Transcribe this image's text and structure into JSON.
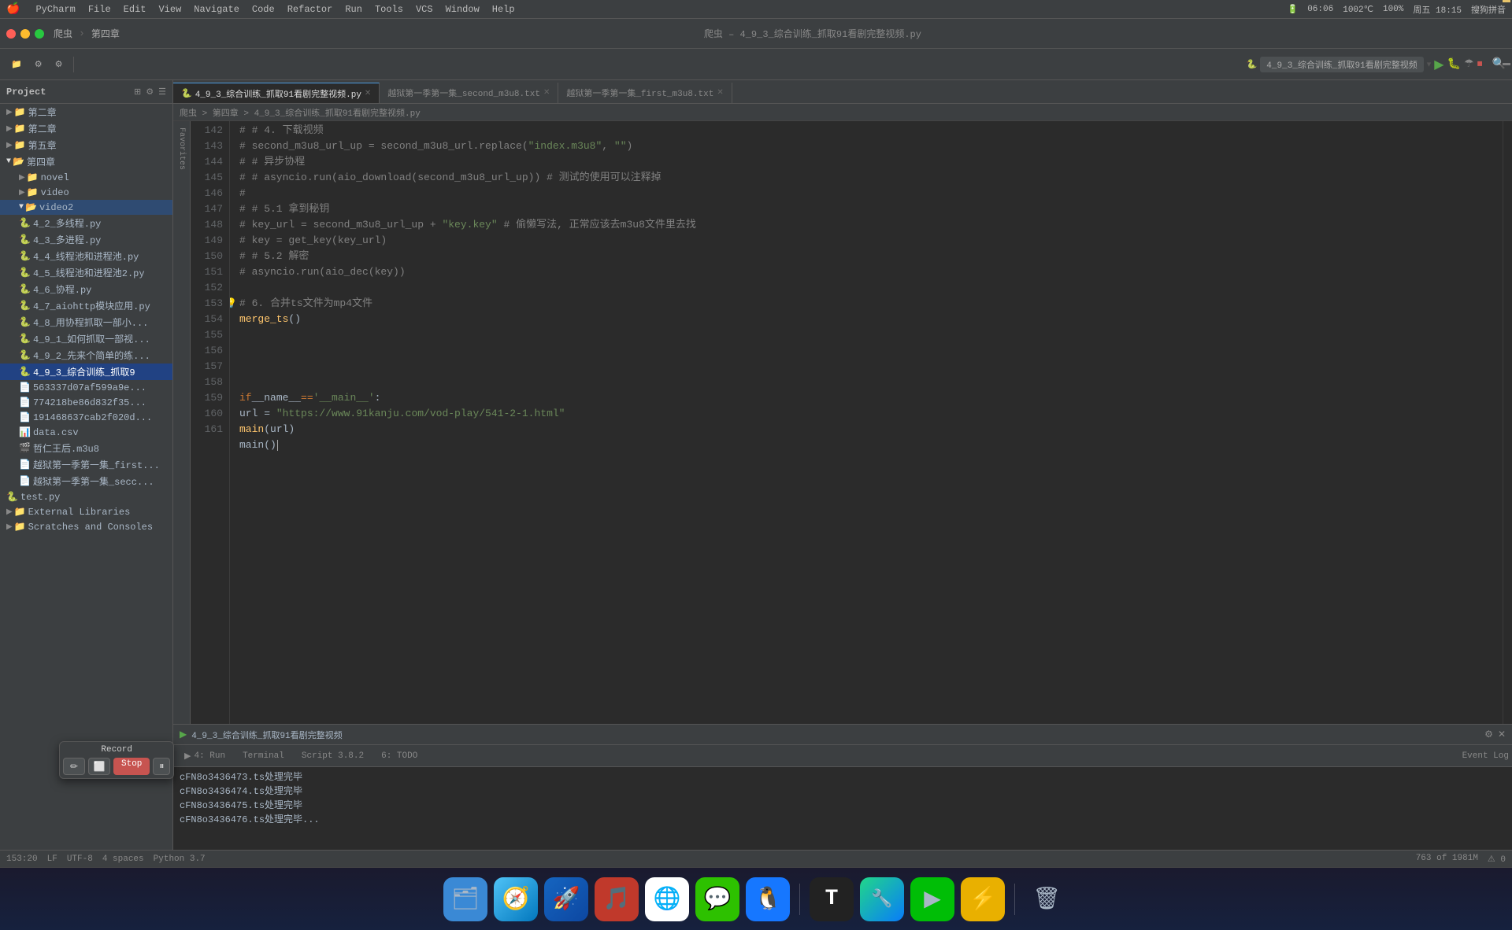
{
  "menubar": {
    "apple": "🍎",
    "items": [
      "PyCharm",
      "File",
      "Edit",
      "View",
      "Navigate",
      "Code",
      "Refactor",
      "Run",
      "Tools",
      "VCS",
      "Window",
      "Help"
    ],
    "right_items": [
      "06:06",
      "1002℃",
      "100%",
      "周五 18:15",
      "搜狗拼音"
    ]
  },
  "titlebar": {
    "title": "爬虫 – 4_9_3_综合训练_抓取91看剧完整视频.py"
  },
  "run_config": {
    "name": "4_9_3_综合训练_抓取91看剧完整视频",
    "run_label": "▶",
    "debug_label": "🐛"
  },
  "project": {
    "title": "Project",
    "tree_items": [
      {
        "label": "第二章",
        "indent": 1,
        "type": "folder",
        "collapsed": true
      },
      {
        "label": "第二章",
        "indent": 1,
        "type": "folder",
        "collapsed": true
      },
      {
        "label": "第五章",
        "indent": 1,
        "type": "folder",
        "collapsed": true
      },
      {
        "label": "第四章",
        "indent": 1,
        "type": "folder",
        "collapsed": false
      },
      {
        "label": "novel",
        "indent": 2,
        "type": "folder",
        "collapsed": true
      },
      {
        "label": "video",
        "indent": 2,
        "type": "folder",
        "collapsed": true
      },
      {
        "label": "video2",
        "indent": 2,
        "type": "folder",
        "collapsed": false,
        "selected": true
      },
      {
        "label": "4_2_多线程.py",
        "indent": 2,
        "type": "py"
      },
      {
        "label": "4_3_多进程.py",
        "indent": 2,
        "type": "py"
      },
      {
        "label": "4_4_线程池和进程池.py",
        "indent": 2,
        "type": "py"
      },
      {
        "label": "4_5_线程池和进程池2.py",
        "indent": 2,
        "type": "py"
      },
      {
        "label": "4_6_协程.py",
        "indent": 2,
        "type": "py"
      },
      {
        "label": "4_7_aiohttp模块应用.py",
        "indent": 2,
        "type": "py"
      },
      {
        "label": "4_8_用协程抓取一部小…",
        "indent": 2,
        "type": "py"
      },
      {
        "label": "4_9_1_如何抓取一部视…",
        "indent": 2,
        "type": "py"
      },
      {
        "label": "4_9_2_先来个简单的练…",
        "indent": 2,
        "type": "py"
      },
      {
        "label": "4_9_3_综合训练_抓取9",
        "indent": 2,
        "type": "py",
        "selected": true
      },
      {
        "label": "563337d07af599a9e…",
        "indent": 2,
        "type": "file"
      },
      {
        "label": "774218be86d832f35…",
        "indent": 2,
        "type": "file"
      },
      {
        "label": "191468637cab2f020d…",
        "indent": 2,
        "type": "file"
      },
      {
        "label": "data.csv",
        "indent": 2,
        "type": "csv"
      },
      {
        "label": "哲仁王后.m3u8",
        "indent": 2,
        "type": "m3u8"
      },
      {
        "label": "越狱第一季第一集_first…",
        "indent": 2,
        "type": "file"
      },
      {
        "label": "越狱第一季第一集_secc…",
        "indent": 2,
        "type": "file"
      },
      {
        "label": "test.py",
        "indent": 1,
        "type": "py"
      },
      {
        "label": "External Libraries",
        "indent": 1,
        "type": "folder",
        "collapsed": true
      },
      {
        "label": "Scratches and Consoles",
        "indent": 1,
        "type": "folder",
        "collapsed": true
      }
    ]
  },
  "tabs": [
    {
      "label": "4_9_3_综合训练_抓取91看剧完整视频.py",
      "active": true
    },
    {
      "label": "越狱第一季第一集_second_m3u8.txt",
      "active": false
    },
    {
      "label": "越狱第一季第一集_first_m3u8.txt",
      "active": false
    }
  ],
  "breadcrumb": "爬虫 > 第四章 > 4_9_3_综合训练_抓取91看剧完整视频.py",
  "code_lines": [
    {
      "num": "142",
      "content": "        # # 4. 下载视频",
      "type": "comment"
    },
    {
      "num": "143",
      "content": "        # second_m3u8_url_up = second_m3u8_url.replace(\"index.m3u8\", \"\")",
      "type": "comment"
    },
    {
      "num": "144",
      "content": "        # # 异步协程",
      "type": "comment"
    },
    {
      "num": "145",
      "content": "        # # asyncio.run(aio_download(second_m3u8_url_up))  # 测试的使用可以注释掉",
      "type": "comment"
    },
    {
      "num": "146",
      "content": "        #",
      "type": "comment"
    },
    {
      "num": "147",
      "content": "        # # 5.1 拿到秘钥",
      "type": "comment"
    },
    {
      "num": "148",
      "content": "        # key_url = second_m3u8_url_up + \"key.key\"  # 偷懒写法, 正常应该去m3u8文件里去找",
      "type": "comment"
    },
    {
      "num": "149",
      "content": "        # key = get_key(key_url)",
      "type": "comment"
    },
    {
      "num": "150",
      "content": "        # # 5.2 解密",
      "type": "comment"
    },
    {
      "num": "151",
      "content": "        # asyncio.run(aio_dec(key))",
      "type": "comment"
    },
    {
      "num": "152",
      "content": "",
      "type": "empty"
    },
    {
      "num": "153",
      "content": "        # 6. 合并ts文件为mp4文件",
      "type": "comment",
      "has_lightbulb": true,
      "has_run": true
    },
    {
      "num": "154",
      "content": "        merge_ts()",
      "type": "normal"
    },
    {
      "num": "155",
      "content": "",
      "type": "empty"
    },
    {
      "num": "156",
      "content": "",
      "type": "empty"
    },
    {
      "num": "157",
      "content": "",
      "type": "empty"
    },
    {
      "num": "158",
      "content": "",
      "type": "empty"
    },
    {
      "num": "159",
      "content": "if __name__ == '__main__':",
      "type": "keyword",
      "has_run": true
    },
    {
      "num": "160",
      "content": "    url = \"https://www.91kanju.com/vod-play/541-2-1.html\"",
      "type": "normal_url"
    },
    {
      "num": "161",
      "content": "    main(url)",
      "type": "normal"
    },
    {
      "num": "",
      "content": "main()",
      "type": "extra"
    }
  ],
  "bottom_panel": {
    "run_title": "4_9_3_综合训练_抓取91看剧完整视频",
    "output_lines": [
      "cFN8o3436473.ts处理完毕",
      "cFN8o3436474.ts处理完毕",
      "cFN8o3436475.ts处理完毕",
      "cFN8o3436476.ts处理完毕"
    ]
  },
  "bottom_tabs": [
    {
      "label": "4: Run",
      "active": true
    },
    {
      "label": "Terminal"
    },
    {
      "label": "Script 3.8.2"
    },
    {
      "label": "6: TODO"
    }
  ],
  "statusbar": {
    "left": "153:20",
    "items": [
      "LF",
      "UTF-8",
      "4 spaces",
      "Python 3.7",
      "763 of 1981M"
    ]
  },
  "record_popup": {
    "label": "Record",
    "stop_label": "Stop",
    "pause_label": "⏸"
  },
  "dock_items": [
    {
      "name": "finder",
      "emoji": "🗂",
      "bg": "#3a89d5"
    },
    {
      "name": "safari",
      "emoji": "🧭",
      "bg": "#3a89d5"
    },
    {
      "name": "launchpad",
      "emoji": "🚀",
      "bg": "#2060a0"
    },
    {
      "name": "netease",
      "emoji": "🎵",
      "bg": "#c0392b"
    },
    {
      "name": "chrome",
      "emoji": "🌐",
      "bg": "#4285f4"
    },
    {
      "name": "wechat",
      "emoji": "💬",
      "bg": "#2dc100"
    },
    {
      "name": "qq",
      "emoji": "🐧",
      "bg": "#1677ff"
    },
    {
      "name": "typora",
      "emoji": "T",
      "bg": "#444"
    },
    {
      "name": "pycharm",
      "emoji": "🔧",
      "bg": "#21d789"
    },
    {
      "name": "iqiyi",
      "emoji": "▶",
      "bg": "#00be06"
    },
    {
      "name": "thunder",
      "emoji": "⚡",
      "bg": "#e9b000"
    },
    {
      "name": "trash",
      "emoji": "🗑",
      "bg": "#808080"
    }
  ]
}
